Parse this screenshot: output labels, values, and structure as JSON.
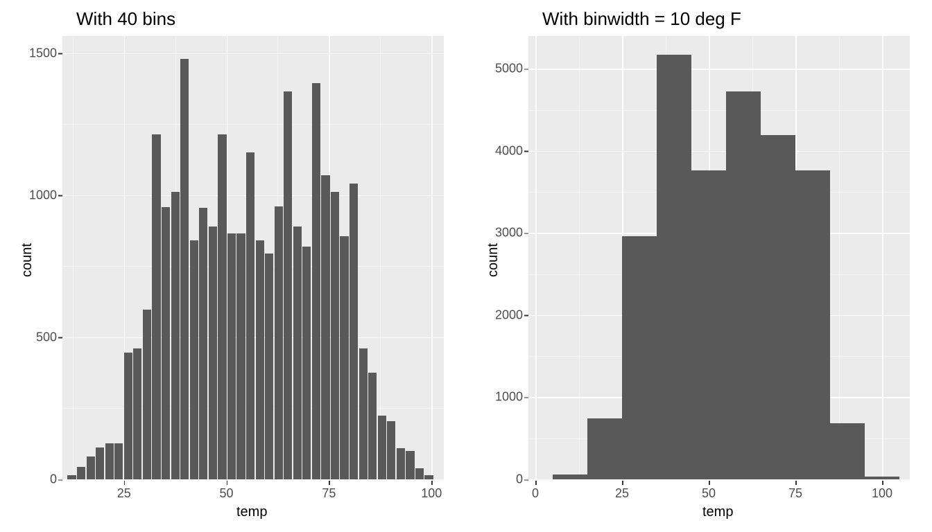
{
  "chart_data": [
    {
      "type": "bar",
      "title": "With 40 bins",
      "xlabel": "temp",
      "ylabel": "count",
      "xlim": [
        10,
        103
      ],
      "ylim": [
        0,
        1560
      ],
      "x_ticks": [
        25,
        50,
        75,
        100
      ],
      "y_ticks": [
        0,
        500,
        1000,
        1500
      ],
      "bin_centers": [
        12.29,
        14.58,
        16.88,
        19.17,
        21.46,
        23.75,
        26.04,
        28.33,
        30.63,
        32.92,
        35.21,
        37.5,
        39.79,
        42.08,
        44.38,
        46.67,
        48.96,
        51.25,
        53.54,
        55.83,
        58.13,
        60.42,
        62.71,
        65.0,
        67.29,
        69.58,
        71.88,
        74.17,
        76.46,
        78.75,
        81.04,
        83.33,
        85.63,
        87.92,
        90.21,
        92.5,
        94.79,
        97.08,
        99.38,
        101.67
      ],
      "values": [
        15,
        44,
        80,
        113,
        128,
        128,
        445,
        460,
        598,
        1215,
        958,
        1012,
        1480,
        840,
        955,
        890,
        1215,
        865,
        865,
        1150,
        840,
        795,
        960,
        1365,
        890,
        820,
        1395,
        1070,
        1012,
        855,
        1040,
        460,
        375,
        225,
        205,
        110,
        100,
        40,
        15,
        0
      ],
      "bar_width_frac": 0.9
    },
    {
      "type": "bar",
      "title": "With binwidth = 10 deg F",
      "xlabel": "temp",
      "ylabel": "count",
      "xlim": [
        -2,
        108
      ],
      "ylim": [
        0,
        5400
      ],
      "x_ticks": [
        0,
        25,
        50,
        75,
        100
      ],
      "y_ticks": [
        0,
        1000,
        2000,
        3000,
        4000,
        5000
      ],
      "bin_centers": [
        10,
        20,
        30,
        40,
        50,
        60,
        70,
        80,
        90,
        100
      ],
      "values": [
        60,
        740,
        2960,
        5170,
        3760,
        4725,
        4190,
        3760,
        680,
        30
      ],
      "bar_width_frac": 1.0,
      "bin_width": 10
    }
  ],
  "titles": {
    "left": "With 40 bins",
    "right": "With binwidth = 10 deg F"
  },
  "axes": {
    "x": "temp",
    "y": "count"
  }
}
